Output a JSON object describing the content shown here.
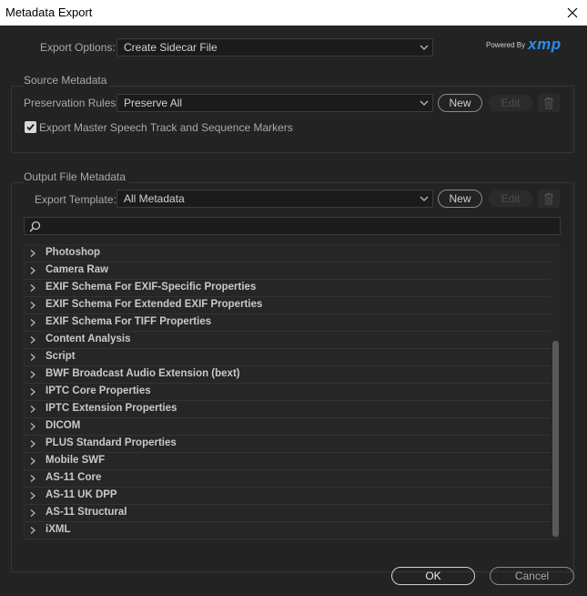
{
  "window": {
    "title": "Metadata Export"
  },
  "export_options": {
    "label": "Export Options:",
    "value": "Create Sidecar File"
  },
  "branding": {
    "powered_by": "Powered By",
    "brand": "xmp",
    "brand_color": "#2d8ceb"
  },
  "source_metadata": {
    "title": "Source Metadata",
    "preservation_label": "Preservation Rules:",
    "preservation_value": "Preserve All",
    "new_label": "New",
    "edit_label": "Edit",
    "checkbox_checked": true,
    "checkbox_label": "Export Master Speech Track and Sequence Markers"
  },
  "output_metadata": {
    "title": "Output File Metadata",
    "template_label": "Export Template:",
    "template_value": "All Metadata",
    "new_label": "New",
    "edit_label": "Edit",
    "search_placeholder": ""
  },
  "tree": {
    "items": [
      "Photoshop",
      "Camera Raw",
      "EXIF Schema For EXIF-Specific Properties",
      "EXIF Schema For Extended EXIF Properties",
      "EXIF Schema For TIFF Properties",
      "Content Analysis",
      "Script",
      "BWF Broadcast Audio Extension (bext)",
      "IPTC Core Properties",
      "IPTC Extension Properties",
      "DICOM",
      "PLUS Standard Properties",
      "Mobile SWF",
      "AS-11 Core",
      "AS-11 UK DPP",
      "AS-11 Structural",
      "iXML"
    ]
  },
  "footer": {
    "ok_label": "OK",
    "cancel_label": "Cancel"
  }
}
